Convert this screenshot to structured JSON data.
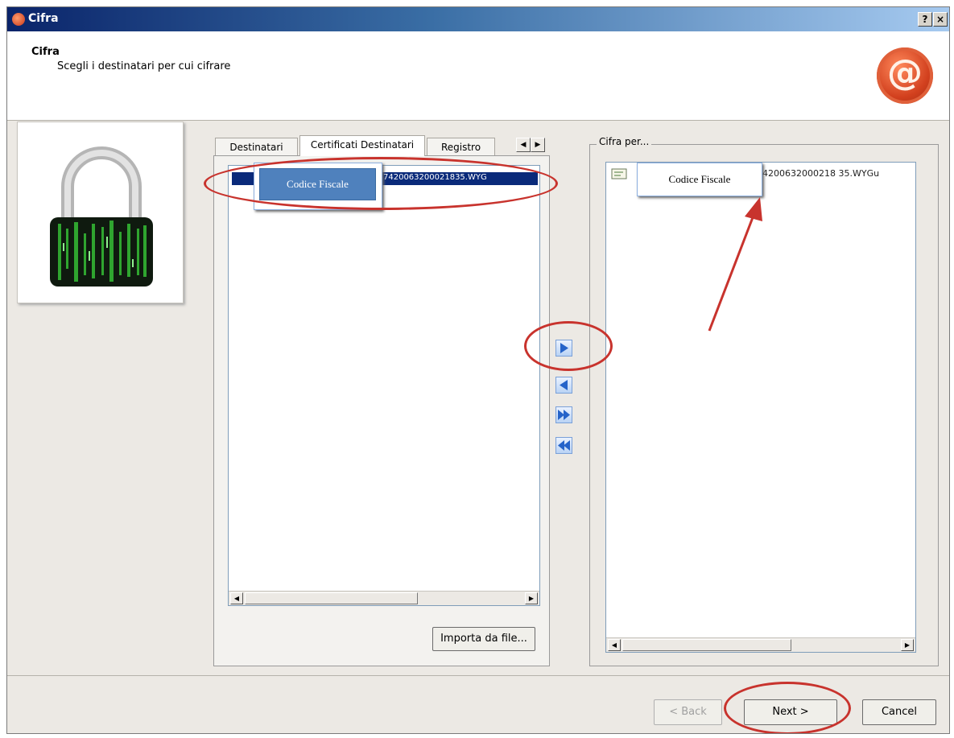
{
  "window": {
    "title": "Cifra",
    "help_btn": "?",
    "close_btn": "×"
  },
  "header": {
    "title": "Cifra",
    "subtitle": "Scegli i destinatari per cui cifrare"
  },
  "left_pane": {
    "tabs": [
      {
        "label": "Destinatari",
        "active": false
      },
      {
        "label": "Certificati Destinatari",
        "active": true
      },
      {
        "label": "Registro",
        "active": false
      }
    ],
    "list_item_suffix": "7420063200021835.WYG",
    "callout": "Codice Fiscale",
    "import_button": "Importa da file..."
  },
  "right_pane": {
    "group_label": "Cifra per...",
    "list_item_suffix": "74200632000218 35.WYGu",
    "callout": "Codice Fiscale"
  },
  "footer": {
    "back_button": "< Back",
    "next_button": "Next >",
    "cancel_button": "Cancel"
  },
  "colors": {
    "annotation": "#c8332d",
    "selection": "#0a2a7a",
    "callout_fill": "#4f81bd"
  },
  "icons": [
    "padlock-icon",
    "seal-icon",
    "certificate-icon",
    "tab-scroll-left-icon",
    "tab-scroll-right-icon"
  ]
}
